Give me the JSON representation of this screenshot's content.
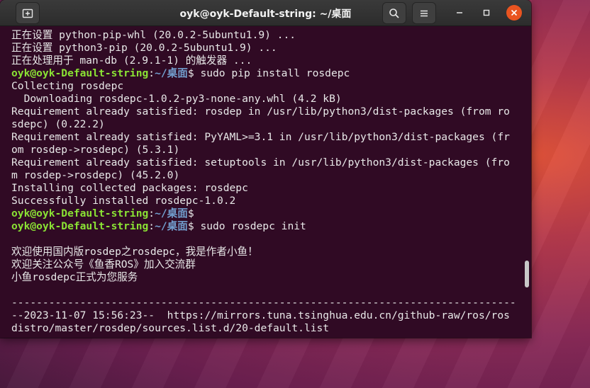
{
  "window": {
    "title": "oyk@oyk-Default-string: ~/桌面",
    "new_tab_icon": "new-tab-icon",
    "search_icon": "search-icon",
    "menu_icon": "hamburger-menu-icon",
    "minimize_icon": "minimize-icon",
    "maximize_icon": "maximize-icon",
    "close_icon": "close-icon"
  },
  "prompt": {
    "user": "oyk@oyk-Default-string",
    "colon": ":",
    "path": "~/桌面",
    "dollar": "$"
  },
  "terminal": {
    "lines": [
      {
        "type": "text",
        "text": "正在设置 python-pip-whl (20.0.2-5ubuntu1.9) ..."
      },
      {
        "type": "text",
        "text": "正在设置 python3-pip (20.0.2-5ubuntu1.9) ..."
      },
      {
        "type": "text",
        "text": "正在处理用于 man-db (2.9.1-1) 的触发器 ..."
      },
      {
        "type": "prompt",
        "cmd": " sudo pip install rosdepc"
      },
      {
        "type": "text",
        "text": "Collecting rosdepc"
      },
      {
        "type": "text",
        "text": "  Downloading rosdepc-1.0.2-py3-none-any.whl (4.2 kB)"
      },
      {
        "type": "text",
        "text": "Requirement already satisfied: rosdep in /usr/lib/python3/dist-packages (from ro"
      },
      {
        "type": "text",
        "text": "sdepc) (0.22.2)"
      },
      {
        "type": "text",
        "text": "Requirement already satisfied: PyYAML>=3.1 in /usr/lib/python3/dist-packages (fr"
      },
      {
        "type": "text",
        "text": "om rosdep->rosdepc) (5.3.1)"
      },
      {
        "type": "text",
        "text": "Requirement already satisfied: setuptools in /usr/lib/python3/dist-packages (fro"
      },
      {
        "type": "text",
        "text": "m rosdep->rosdepc) (45.2.0)"
      },
      {
        "type": "text",
        "text": "Installing collected packages: rosdepc"
      },
      {
        "type": "text",
        "text": "Successfully installed rosdepc-1.0.2"
      },
      {
        "type": "prompt",
        "cmd": ""
      },
      {
        "type": "prompt",
        "cmd": " sudo rosdepc init"
      },
      {
        "type": "text",
        "text": ""
      },
      {
        "type": "text",
        "text": "欢迎使用国内版rosdep之rosdepc，我是作者小鱼！"
      },
      {
        "type": "text",
        "text": "欢迎关注公众号《鱼香ROS》加入交流群"
      },
      {
        "type": "text",
        "text": "小鱼rosdepc正式为您服务"
      },
      {
        "type": "text",
        "text": ""
      },
      {
        "type": "text",
        "text": "---------------------------------------------------------------------------------"
      },
      {
        "type": "text",
        "text": "--2023-11-07 15:56:23--  https://mirrors.tuna.tsinghua.edu.cn/github-raw/ros/ros"
      },
      {
        "type": "text",
        "text": "distro/master/rosdep/sources.list.d/20-default.list"
      }
    ]
  }
}
